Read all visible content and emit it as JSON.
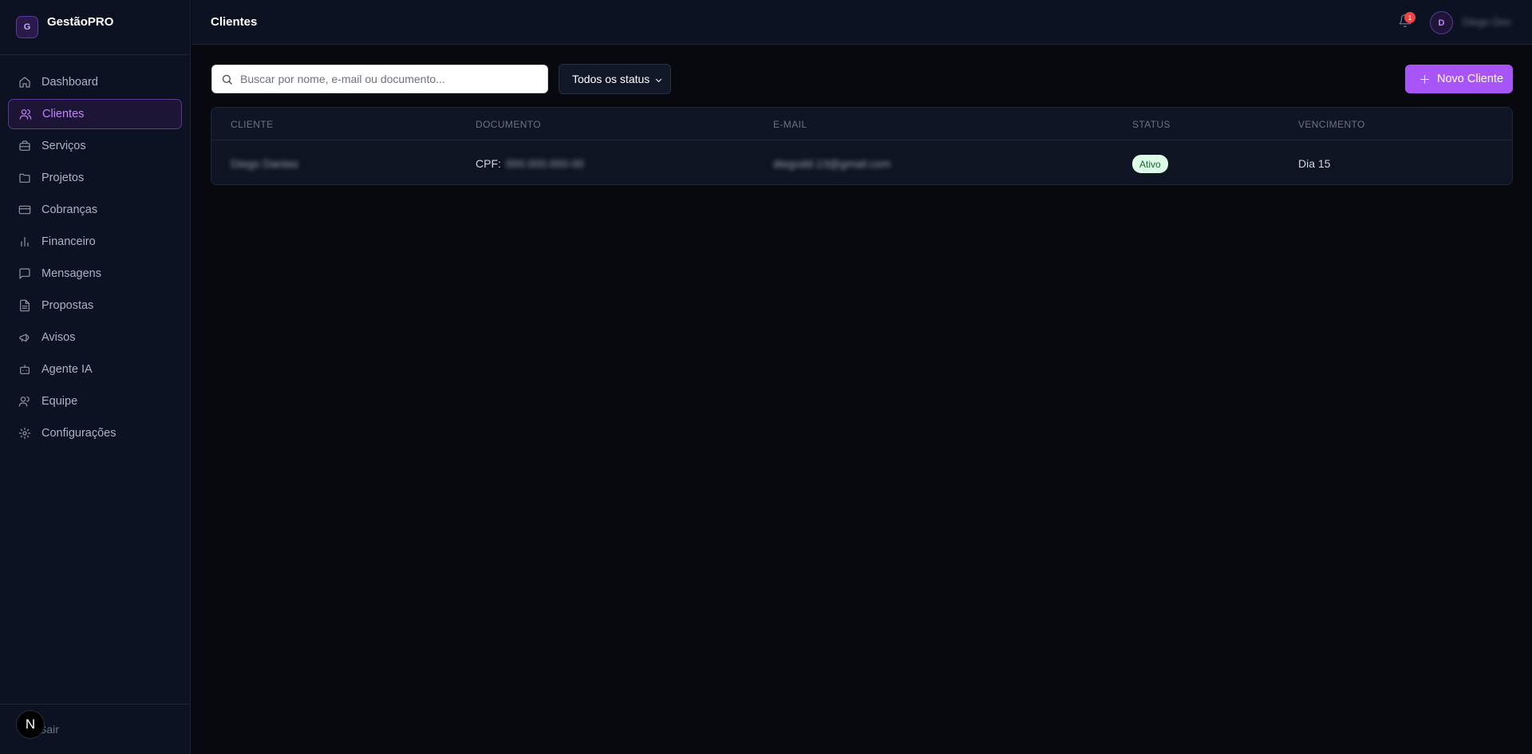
{
  "brand": {
    "logo_letter": "G",
    "name": "GestãoPRO"
  },
  "sidebar": {
    "items": [
      {
        "label": "Dashboard",
        "icon": "home-icon",
        "active": false
      },
      {
        "label": "Clientes",
        "icon": "users-icon",
        "active": true
      },
      {
        "label": "Serviços",
        "icon": "briefcase-icon",
        "active": false
      },
      {
        "label": "Projetos",
        "icon": "folder-icon",
        "active": false
      },
      {
        "label": "Cobranças",
        "icon": "credit-card-icon",
        "active": false
      },
      {
        "label": "Financeiro",
        "icon": "bar-chart-icon",
        "active": false
      },
      {
        "label": "Mensagens",
        "icon": "message-icon",
        "active": false
      },
      {
        "label": "Propostas",
        "icon": "file-text-icon",
        "active": false
      },
      {
        "label": "Avisos",
        "icon": "megaphone-icon",
        "active": false
      },
      {
        "label": "Agente IA",
        "icon": "bot-icon",
        "active": false
      },
      {
        "label": "Equipe",
        "icon": "team-icon",
        "active": false
      },
      {
        "label": "Configurações",
        "icon": "gear-icon",
        "active": false
      }
    ],
    "logout_label": "Sair",
    "n_badge": "N"
  },
  "header": {
    "title": "Clientes",
    "notification_count": "1",
    "avatar_letter": "D",
    "user_name": "Diego Dev"
  },
  "toolbar": {
    "search_placeholder": "Buscar por nome, e-mail ou documento...",
    "status_filter": "Todos os status",
    "new_button": "Novo Cliente"
  },
  "table": {
    "columns": [
      "CLIENTE",
      "DOCUMENTO",
      "E-MAIL",
      "STATUS",
      "VENCIMENTO"
    ],
    "rows": [
      {
        "cliente": "Diego Dantas",
        "documento_prefix": "CPF:",
        "documento": "000.000.000-00",
        "email": "diegodd.13@gmail.com",
        "status": "Ativo",
        "vencimento": "Dia 15"
      }
    ]
  },
  "colors": {
    "accent": "#a855f7",
    "sidebar_bg": "#0c1221",
    "page_bg": "#07090f",
    "status_active_bg": "#dcfce7",
    "status_active_text": "#166534"
  }
}
